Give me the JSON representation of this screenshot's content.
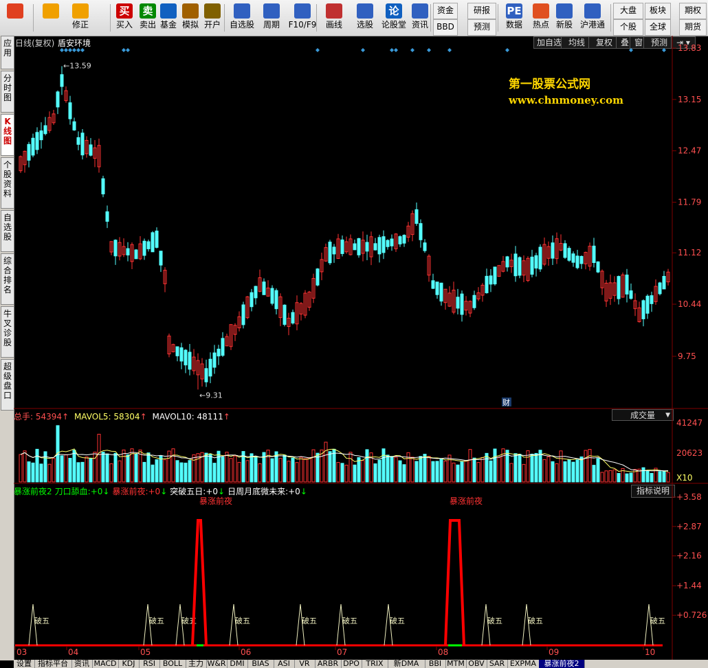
{
  "toolbar": {
    "buttons": [
      {
        "label": "",
        "icon": "windows-icon"
      },
      {
        "label": "",
        "icon": "back-arrow-icon"
      },
      {
        "label": "修正",
        "icon": "updown-icon"
      },
      {
        "label": "买入",
        "icon": "buy-icon",
        "glyph": "买"
      },
      {
        "label": "卖出",
        "icon": "sell-icon",
        "glyph": "卖"
      },
      {
        "label": "基金",
        "icon": "fund-icon"
      },
      {
        "label": "模拟",
        "icon": "hammer-icon"
      },
      {
        "label": "开户",
        "icon": "lock-icon"
      },
      {
        "label": "自选股",
        "icon": "star-icon"
      },
      {
        "label": "周期",
        "icon": "clock-icon"
      },
      {
        "label": "F10/F9",
        "icon": "f10-icon"
      },
      {
        "label": "画线",
        "icon": "pen-icon"
      },
      {
        "label": "选股",
        "icon": "select-icon"
      },
      {
        "label": "论股堂",
        "icon": "forum-icon",
        "glyph": "论"
      },
      {
        "label": "资讯",
        "icon": "news-icon"
      },
      {
        "label": "数据",
        "icon": "pe-icon",
        "glyph": "PE"
      },
      {
        "label": "热点",
        "icon": "hot-icon"
      },
      {
        "label": "新股",
        "icon": "ipo-icon"
      },
      {
        "label": "沪港通",
        "icon": "hk-icon"
      }
    ],
    "small_buttons": [
      "资金",
      "BBD",
      "研报",
      "预测",
      "大盘",
      "个股",
      "板块",
      "全球",
      "期权",
      "期货"
    ]
  },
  "sidebar": {
    "tabs": [
      "应用",
      "分时图",
      "K线图",
      "个股资料",
      "自选股",
      "综合排名",
      "牛叉诊股",
      "超级盘口"
    ],
    "active": "K线图"
  },
  "kline": {
    "period_label": "日线(复权)",
    "stock_name": "盾安环境",
    "buttons": [
      "加自选",
      "均线",
      "复权",
      "叠",
      "窗",
      "预测"
    ],
    "price_axis": [
      "13.83",
      "13.15",
      "12.47",
      "11.79",
      "11.12",
      "10.44",
      "9.75"
    ],
    "high_label": "13.59",
    "low_label": "9.31",
    "watermark_title": "第一股票公式网",
    "watermark_url": "www.chnmoney.com",
    "finance_marker": "财",
    "accent_up": "#ff3232",
    "accent_down": "#54ffff"
  },
  "volume": {
    "label": "总手:",
    "value": "54394",
    "ma5_label": "MAVOL5:",
    "ma5_value": "58304",
    "ma10_label": "MAVOL10:",
    "ma10_value": "48111",
    "selector": "成交量",
    "axis": [
      "41247",
      "20623"
    ],
    "unit": "X10"
  },
  "indicator": {
    "name": "暴涨前夜2",
    "items": [
      {
        "label": "刀口舔血:",
        "value": "+0",
        "color": "#00ff00"
      },
      {
        "label": "暴涨前夜:",
        "value": "+0",
        "color": "#ff3232"
      },
      {
        "label": "突破五日:",
        "value": "+0",
        "color": "#ffffff"
      },
      {
        "label": "日周月底微未来:",
        "value": "+0",
        "color": "#ffffff"
      }
    ],
    "help_button": "指标说明",
    "axis": [
      "+3.58",
      "+2.87",
      "+2.16",
      "+1.44",
      "+0.726"
    ],
    "signal_label": "暴涨前夜",
    "break_label": "破五"
  },
  "date_axis": [
    "03",
    "04",
    "05",
    "06",
    "07",
    "08",
    "09",
    "10"
  ],
  "bottom_tabs": [
    "设置",
    "指标平台",
    "资讯",
    "MACD",
    "KDJ",
    "RSI",
    "BOLL",
    "主力",
    "W&R",
    "DMI",
    "BIAS",
    "ASI",
    "VR",
    "ARBR",
    "DPO",
    "TRIX",
    "新DMA",
    "BBI",
    "MTM",
    "OBV",
    "SAR",
    "EXPMA",
    "暴涨前夜2"
  ],
  "bottom_active": "暴涨前夜2"
}
